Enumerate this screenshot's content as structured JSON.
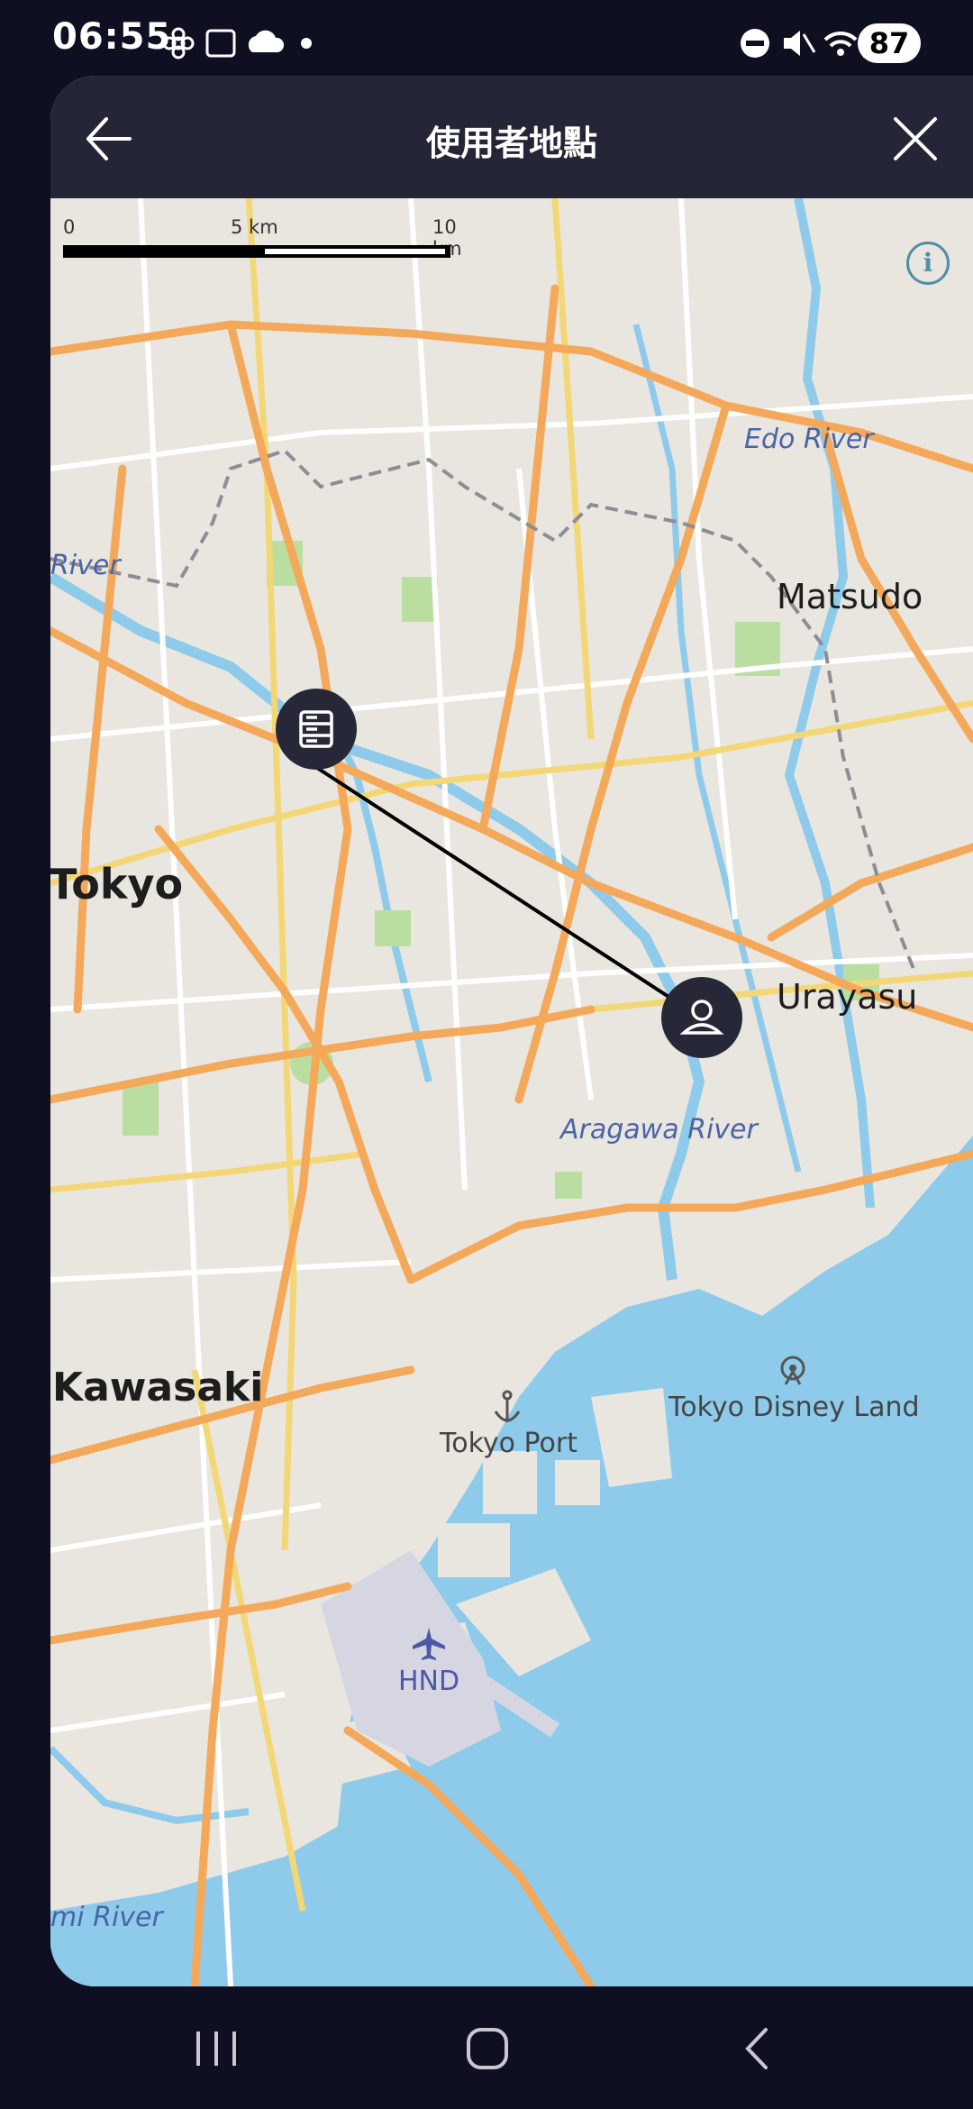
{
  "status": {
    "time": "06:55",
    "battery": "87"
  },
  "header": {
    "title": "使用者地點"
  },
  "map": {
    "scale": {
      "labels": [
        "0",
        "5 km",
        "10 km"
      ]
    },
    "places": {
      "matsudo": "Matsudo",
      "tokyo": "Tokyo",
      "urayasu": "Urayasu",
      "kawasaki": "Kawasaki"
    },
    "water": {
      "edo_river": "Edo River",
      "river_left": "River",
      "aragawa_river": "Aragawa River",
      "mi_river": "mi River"
    },
    "poi": {
      "tokyo_port": "Tokyo Port",
      "tokyo_disney_land": "Tokyo Disney Land",
      "hnd": "HND"
    },
    "markers": {
      "server": "server-marker",
      "user": "user-marker"
    },
    "colors": {
      "land": "#e9e6df",
      "water": "#8ecbeb",
      "major_road": "#f4a85a",
      "minor_road": "#f3d776",
      "park": "#b9dea0",
      "marker": "#262838",
      "connection_line": "#000000"
    }
  }
}
